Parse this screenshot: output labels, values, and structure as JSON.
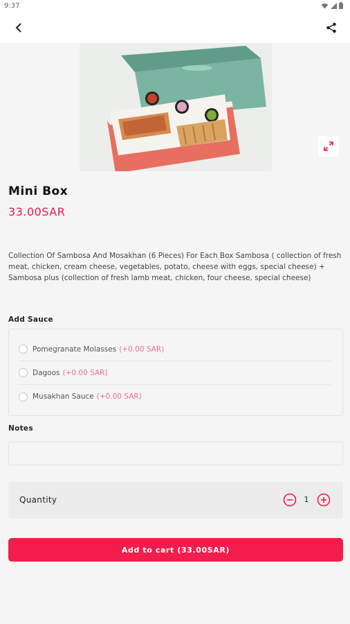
{
  "status_bar": {
    "time": "9:37"
  },
  "product": {
    "title": "Mini Box",
    "price": "33.00SAR",
    "description": "Collection Of Sambosa And Mosakhan (6 Pieces) For Each Box Sambosa ( collection of fresh meat, chicken, cream cheese, vegetables, potato, cheese with eggs, special cheese) + Sambosa plus (collection of fresh lamb meat, chicken, four cheese, special cheese)",
    "image_alt": "Mini box of sambosa with sauces"
  },
  "sauce": {
    "label": "Add Sauce",
    "options": [
      {
        "name": "Pomegranate Molasses",
        "price": "(+0.00 SAR)"
      },
      {
        "name": "Dagoos",
        "price": "(+0.00 SAR)"
      },
      {
        "name": "Musakhan Sauce",
        "price": "(+0.00 SAR)"
      }
    ]
  },
  "notes": {
    "label": "Notes",
    "value": "",
    "placeholder": ""
  },
  "quantity": {
    "label": "Quantity",
    "value": "1"
  },
  "cart_button": {
    "label": "Add to cart (33.00SAR)"
  },
  "colors": {
    "accent": "#f21d4d",
    "price": "#e8184a",
    "sauce_price": "#e8718e",
    "background": "#f5f5f5"
  },
  "icons": {
    "back": "chevron-left-icon",
    "share": "share-icon",
    "expand": "expand-icon",
    "minus": "minus-circle-icon",
    "plus": "plus-circle-icon"
  }
}
